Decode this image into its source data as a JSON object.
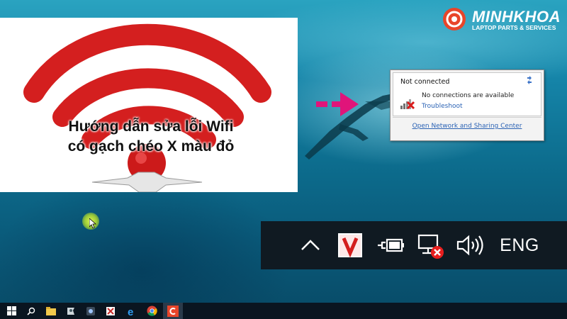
{
  "thumbnail": {
    "title_line1": "Hướng dẫn sửa lỗi Wifi",
    "title_line2": "có gạch chéo X màu đỏ",
    "wifi_color": "#d41f1f"
  },
  "logo": {
    "name": "MINHKHOA",
    "tagline": "LAPTOP PARTS & SERVICES",
    "color": "#e8452a"
  },
  "network_popup": {
    "status": "Not connected",
    "message": "No connections are available",
    "troubleshoot": "Troubleshoot",
    "footer_link": "Open Network and Sharing Center"
  },
  "tray": {
    "language": "ENG",
    "icons": [
      "chevron-up-icon",
      "app-v-icon",
      "battery-plug-icon",
      "network-disconnected-icon",
      "volume-icon"
    ]
  },
  "arrow_color": "#e0147a",
  "taskbar": {
    "icons": [
      "windows-start-icon",
      "search-icon",
      "file-explorer-icon",
      "app-icon",
      "app-icon",
      "app-icon",
      "internet-explorer-icon",
      "chrome-icon",
      "recorder-icon"
    ]
  }
}
